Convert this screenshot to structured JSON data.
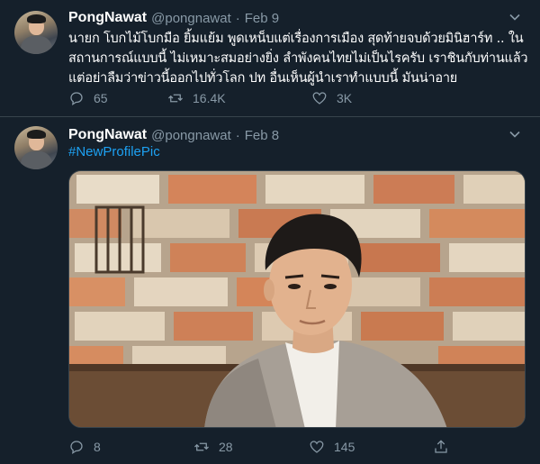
{
  "tweets": [
    {
      "name": "PongNawat",
      "handle": "@pongnawat",
      "separator": "·",
      "date": "Feb 9",
      "text_lines": [
        "นายก โบกไม้โบกมือ ยิ้มแย้ม พูดเหน็บแต่เรื่องการเมือง สุดท้ายจบด้วยมินิฮาร์ท .. ใน",
        "สถานการณ์แบบนี้ ไม่เหมาะสมอย่างยิ่ง ลำพังคนไทยไม่เป็นไรครับ เราชินกับท่านแล้ว",
        "แต่อย่าลืมว่าข่าวนี้ออกไปทั่วโลก ปท อื่นเห็นผู้นำเราทำแบบนี้ มันน่าอาย"
      ],
      "replies": "65",
      "retweets": "16.4K",
      "likes": "3K",
      "icons": {
        "more": "chevron-down-icon",
        "reply": "reply-icon",
        "retweet": "retweet-icon",
        "like": "heart-icon"
      }
    },
    {
      "name": "PongNawat",
      "handle": "@pongnawat",
      "separator": "·",
      "date": "Feb 8",
      "text": "#NewProfilePic",
      "replies": "8",
      "retweets": "28",
      "likes": "145",
      "icons": {
        "more": "chevron-down-icon",
        "reply": "reply-icon",
        "retweet": "retweet-icon",
        "like": "heart-icon",
        "share": "share-icon"
      }
    }
  ],
  "colors": {
    "background": "#15202b",
    "divider": "#38444d",
    "secondary_text": "#8899a6",
    "link": "#1da1f2"
  }
}
